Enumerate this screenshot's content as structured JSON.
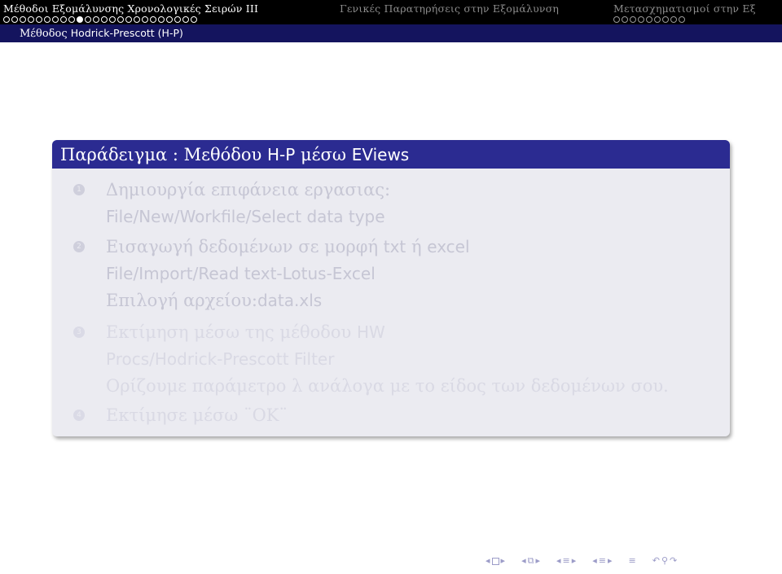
{
  "header": {
    "sections": [
      {
        "title": "Μέθοδοι Εξομάλυνσης Χρονολογικές Σειρών ΙΙΙ",
        "active": true
      },
      {
        "title": "Γενικές Παρατηρήσεις στην Εξομάλυνση",
        "active": false
      },
      {
        "title": "Μετασχηματισμοί στην Εξ",
        "active": false
      }
    ],
    "subsection_prefix": "Μέθοδος",
    "subsection_name": "Hodrick-Prescott (H-P)"
  },
  "block": {
    "title_part1": "Παράδειγμα : Μεθόδου",
    "title_part2": "H-P",
    "title_part3": "μέσω",
    "title_part4": "EViews",
    "items": [
      {
        "number": "1",
        "lines": [
          {
            "serif": "Δημιουργία επιφάνεια εργασιας:",
            "sans": ""
          },
          {
            "serif": "",
            "sans": "File/New/Workfile/Select data type"
          }
        ]
      },
      {
        "number": "2",
        "lines": [
          {
            "serif": "Εισαγωγή δεδομένων σε μορφή",
            "sans": "txt",
            "serif2": "ή",
            "sans2": "excel"
          },
          {
            "serif": "",
            "sans": "File/Import/Read text-Lotus-Excel"
          },
          {
            "serif": "Επιλογή αρχείου:",
            "sans": "data.xls"
          }
        ]
      },
      {
        "number": "3",
        "lines": [
          {
            "serif": "Εκτίμηση μέσω της μέθοδου",
            "sans": "HW"
          },
          {
            "serif": "",
            "sans": "Procs/Hodrick-Prescott Filter"
          },
          {
            "serif": "Ορίζουμε παράμετρο λ ανάλογα με το είδος των δεδομένων σου.",
            "sans": ""
          }
        ]
      },
      {
        "number": "4",
        "lines": [
          {
            "serif": "Εκτίμησε μέσω ¨ΟΚ¨",
            "sans": ""
          }
        ]
      }
    ]
  }
}
